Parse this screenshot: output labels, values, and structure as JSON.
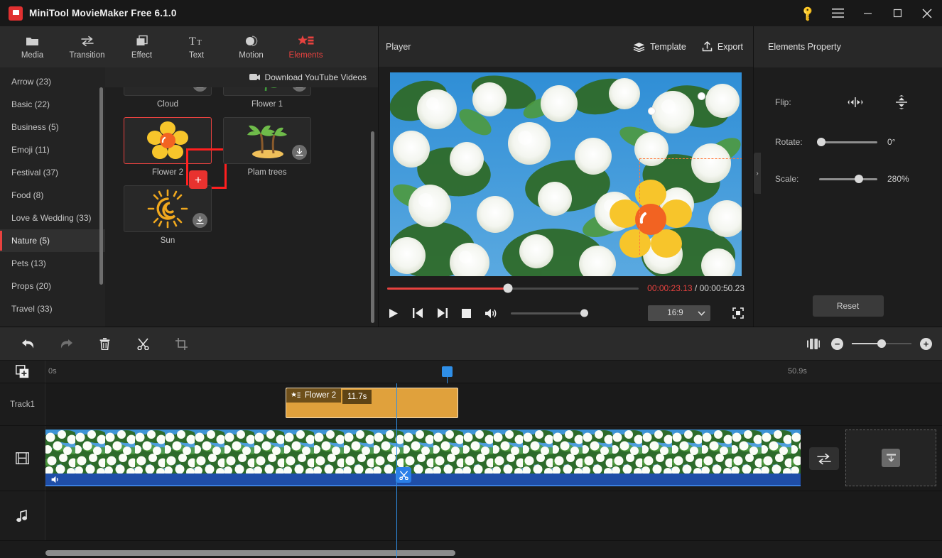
{
  "window": {
    "title": "MiniTool MovieMaker Free 6.1.0",
    "key_icon": "key-icon",
    "menu_icon": "hamburger-menu-icon",
    "minimize_icon": "minimize-icon",
    "maximize_icon": "maximize-icon",
    "close_icon": "close-icon"
  },
  "ribbon": {
    "items": [
      {
        "label": "Media",
        "icon": "folder-icon",
        "active": false
      },
      {
        "label": "Transition",
        "icon": "transition-icon",
        "active": false
      },
      {
        "label": "Effect",
        "icon": "effect-icon",
        "active": false
      },
      {
        "label": "Text",
        "icon": "text-icon",
        "active": false
      },
      {
        "label": "Motion",
        "icon": "motion-icon",
        "active": false
      },
      {
        "label": "Elements",
        "icon": "elements-icon",
        "active": true
      }
    ]
  },
  "categories": [
    {
      "label": "Arrow (23)",
      "active": false
    },
    {
      "label": "Basic (22)",
      "active": false
    },
    {
      "label": "Business (5)",
      "active": false
    },
    {
      "label": "Emoji (11)",
      "active": false
    },
    {
      "label": "Festival (37)",
      "active": false
    },
    {
      "label": "Food (8)",
      "active": false
    },
    {
      "label": "Love & Wedding (33)",
      "active": false
    },
    {
      "label": "Nature (5)",
      "active": true
    },
    {
      "label": "Pets (13)",
      "active": false
    },
    {
      "label": "Props (20)",
      "active": false
    },
    {
      "label": "Travel (33)",
      "active": false
    }
  ],
  "download_bar": {
    "label": "Download YouTube Videos",
    "icon": "youtube-download-icon"
  },
  "elements": [
    {
      "label": "Cloud",
      "state": "downloadable",
      "icon": "cloud-sticker"
    },
    {
      "label": "Flower 1",
      "state": "downloadable",
      "icon": "daisy-sticker"
    },
    {
      "label": "Flower 2",
      "state": "selected",
      "icon": "yellow-flower-sticker",
      "add_label": "+"
    },
    {
      "label": "Plam trees",
      "state": "downloadable",
      "icon": "palm-trees-sticker"
    },
    {
      "label": "Sun",
      "state": "downloadable",
      "icon": "sun-sticker"
    }
  ],
  "player": {
    "title": "Player",
    "template_label": "Template",
    "export_label": "Export",
    "current_time": "00:00:23.13",
    "separator": "/",
    "total_time": "00:00:50.23",
    "progress_percent": 48,
    "aspect_ratio": "16:9",
    "volume_percent": 100,
    "controls": [
      "play-button",
      "previous-frame-button",
      "next-frame-button",
      "stop-button",
      "volume-button"
    ],
    "fullscreen_icon": "fullscreen-icon"
  },
  "properties": {
    "title": "Elements Property",
    "flip_label": "Flip:",
    "flip_horizontal_icon": "flip-horizontal-icon",
    "flip_vertical_icon": "flip-vertical-icon",
    "rotate_label": "Rotate:",
    "rotate_value": "0°",
    "rotate_percent": 4,
    "scale_label": "Scale:",
    "scale_value": "280%",
    "scale_percent": 68,
    "reset_label": "Reset",
    "collapse_icon": "chevron-right-icon"
  },
  "timeline": {
    "toolbar": [
      {
        "icon": "undo-icon",
        "enabled": true
      },
      {
        "icon": "redo-icon",
        "enabled": false
      },
      {
        "icon": "delete-icon",
        "enabled": true
      },
      {
        "icon": "split-icon",
        "enabled": true
      },
      {
        "icon": "crop-icon",
        "enabled": true
      }
    ],
    "fit_icon": "fit-to-timeline-icon",
    "zoom_out_label": "−",
    "zoom_in_label": "+",
    "zoom_percent": 50,
    "add_track_icon": "add-media-icon",
    "ruler_start": "0s",
    "ruler_end": "50.9s",
    "tracks": [
      {
        "name": "Track1",
        "type": "element"
      },
      {
        "name": "video-track",
        "icon": "film-icon",
        "type": "video"
      },
      {
        "name": "audio-track",
        "icon": "music-note-icon",
        "type": "audio"
      }
    ],
    "element_clip": {
      "name": "Flower 2",
      "duration": "11.7s",
      "icon": "elements-icon"
    },
    "split_marker_icon": "scissors-icon",
    "transition_icon": "transition-arrows-icon",
    "dropzone_icon": "import-icon",
    "mute_icon": "speaker-icon"
  }
}
